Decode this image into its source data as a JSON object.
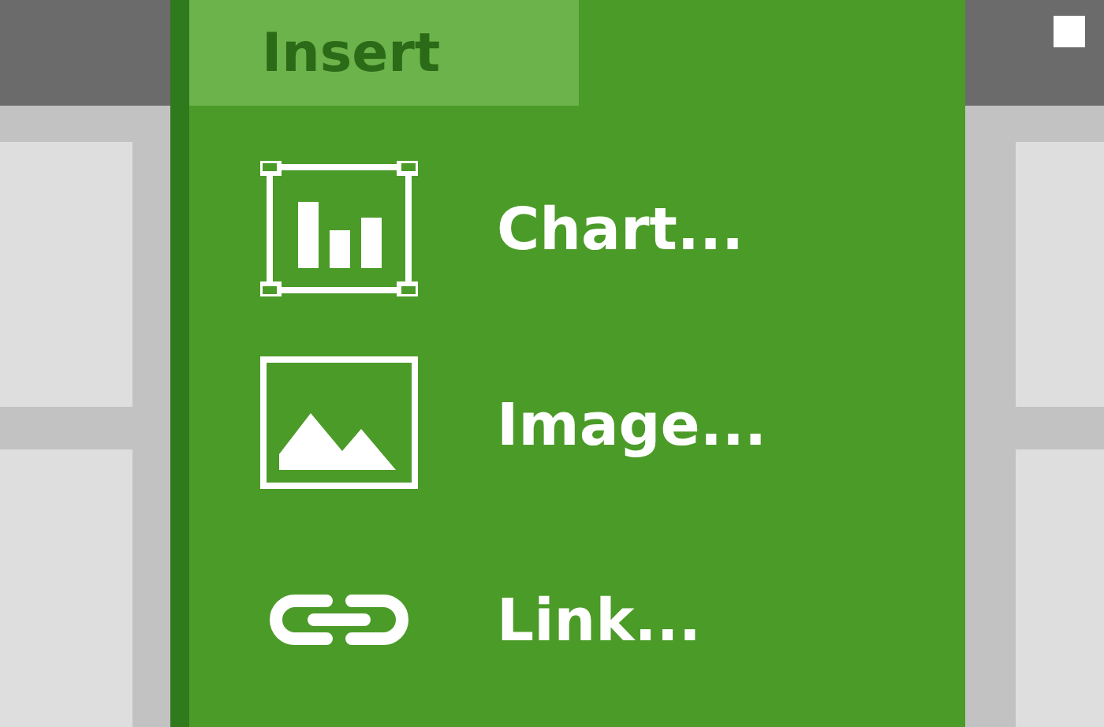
{
  "menu": {
    "title": "Insert",
    "items": [
      {
        "label": "Chart...",
        "kind": "chart"
      },
      {
        "label": "Image...",
        "kind": "image"
      },
      {
        "label": "Link...",
        "kind": "link"
      }
    ]
  }
}
